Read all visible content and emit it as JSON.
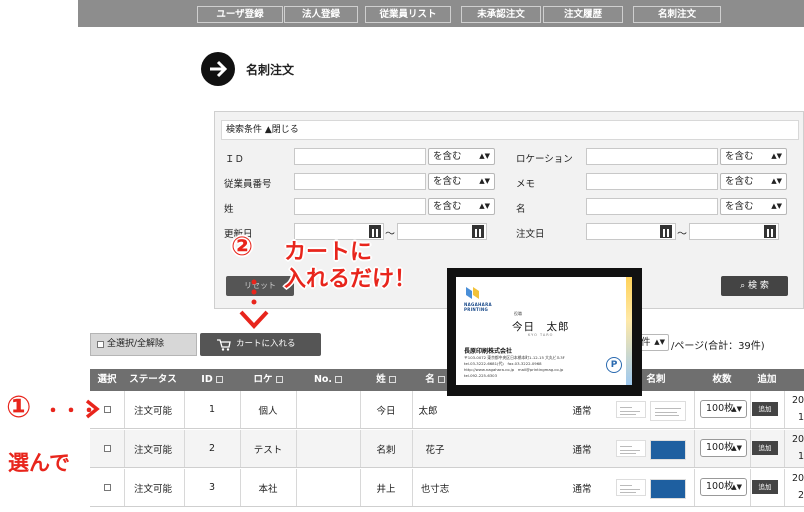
{
  "nav": {
    "items": [
      "ユーザ登録",
      "法人登録",
      "従業員リスト",
      "未承認注文",
      "注文履歴",
      "名刺注文"
    ]
  },
  "page": {
    "title": "名刺注文"
  },
  "search": {
    "header": "検索条件 ▲閉じる",
    "labels": {
      "id": "ＩＤ",
      "location": "ロケーション",
      "employee_no": "従業員番号",
      "memo": "メモ",
      "last_name": "姓",
      "first_name": "名",
      "updated": "更新日",
      "order_date": "注文日"
    },
    "match_option": "を含む",
    "range_sep": "〜",
    "search_button": "検 索",
    "reset_button": "リセット"
  },
  "actions": {
    "select_all": "全選択/全解除",
    "add_to_cart": "カートに入れる",
    "per_page_value": "件",
    "total_text": "/ページ(合計：39件)"
  },
  "table": {
    "headers": [
      "選択",
      "ステータス",
      "ID",
      "ロケ",
      "No.",
      "姓",
      "名",
      "",
      "",
      "名刺",
      "枚数",
      "追加"
    ],
    "rows": [
      {
        "status": "注文可能",
        "id": "1",
        "loc": "個人",
        "no": "",
        "last": "今日",
        "first": "太郎",
        "type": "通常",
        "qty": "100枚",
        "add": "追加",
        "date": "20",
        "date2": "1"
      },
      {
        "status": "注文可能",
        "id": "2",
        "loc": "テスト",
        "no": "",
        "last": "名刺",
        "first": "花子",
        "type": "通常",
        "qty": "100枚",
        "add": "追加",
        "date": "20",
        "date2": "1"
      },
      {
        "status": "注文可能",
        "id": "3",
        "loc": "本社",
        "no": "",
        "last": "井上",
        "first": "也寸志",
        "type": "通常",
        "qty": "100枚",
        "add": "追加",
        "date": "20",
        "date2": "2"
      }
    ]
  },
  "annotations": {
    "step1_num": "①",
    "step1_dots": "・・・",
    "step1_text": "選んで",
    "step2_num": "②",
    "step2_line1": "カートに",
    "step2_line2": "入れるだけ！",
    "color": "#e8251c"
  },
  "card": {
    "logo_text": "NAGAHARA\nPRINTING",
    "role": "役職",
    "name": "今日　太郎",
    "romaji": "KYO TARO",
    "company": "長原印刷株式会社",
    "addr1": "〒103-0072 東京都中央区日本橋本町1-12-15 大丸ビル3F",
    "addr2": "tel.03-3222-6681(代)　fax.03-3222-0968",
    "addr3": "http://www.nagahara.co.jp　mail@printingmag.co.jp",
    "addr4": "tel.092-225-6303",
    "pmark": "P"
  }
}
